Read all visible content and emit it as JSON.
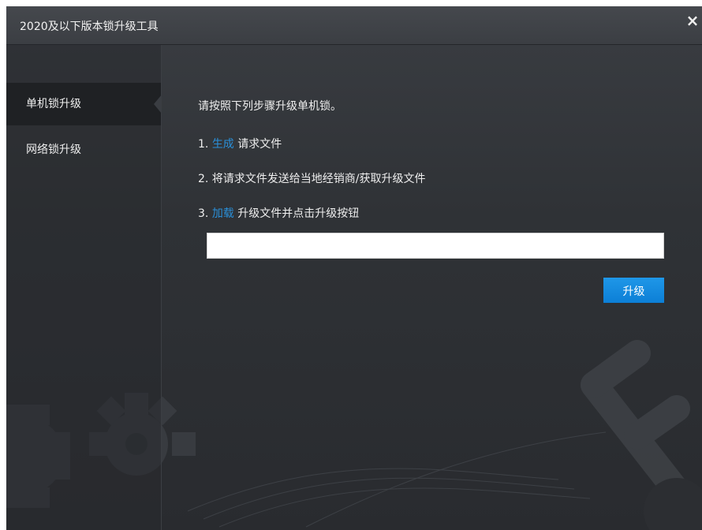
{
  "window": {
    "title": "2020及以下版本锁升级工具",
    "close_icon": "×"
  },
  "sidebar": {
    "items": [
      {
        "label": "单机锁升级",
        "active": true
      },
      {
        "label": "网络锁升级",
        "active": false
      }
    ]
  },
  "main": {
    "intro": "请按照下列步骤升级单机锁。",
    "step1_prefix": "1.",
    "step1_link": "生成",
    "step1_suffix": "请求文件",
    "step2": "2. 将请求文件发送给当地经销商/获取升级文件",
    "step3_prefix": "3.",
    "step3_link": "加载",
    "step3_suffix": "升级文件并点击升级按钮",
    "file_path_value": "",
    "upgrade_button": "升级"
  },
  "colors": {
    "link": "#2a8fd8",
    "button": "#1a8fe2",
    "background": "#2f3236"
  }
}
